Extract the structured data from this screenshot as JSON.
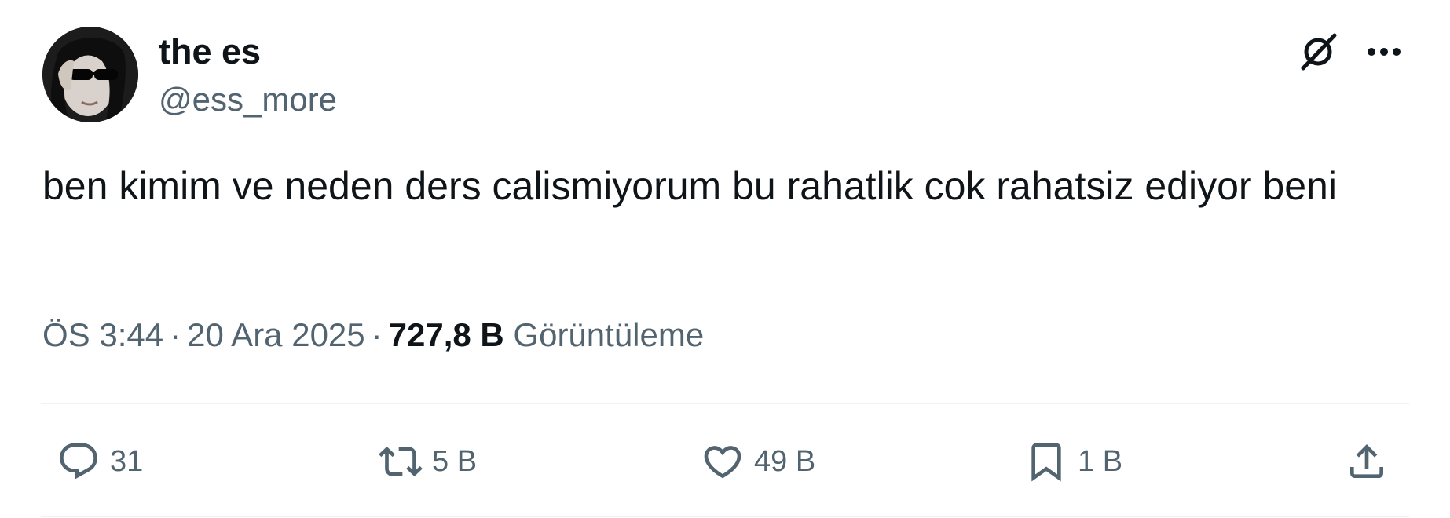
{
  "author": {
    "display_name": "the es",
    "handle": "@ess_more",
    "avatar_icon": "profile-photo"
  },
  "header_actions": {
    "grok_icon": "grok-icon",
    "more_icon": "more-dots-icon"
  },
  "tweet": {
    "text": "ben kimim ve neden ders calismiyorum bu rahatlik cok rahatsiz ediyor beni"
  },
  "meta": {
    "time": "ÖS 3:44",
    "separator": "·",
    "date": "20 Ara 2025",
    "views_count": "727,8 B",
    "views_label": "Görüntüleme"
  },
  "actions": {
    "reply": {
      "icon": "reply-icon",
      "count": "31"
    },
    "retweet": {
      "icon": "retweet-icon",
      "count": "5 B"
    },
    "like": {
      "icon": "heart-icon",
      "count": "49 B"
    },
    "bookmark": {
      "icon": "bookmark-icon",
      "count": "1 B"
    },
    "share": {
      "icon": "share-icon"
    }
  },
  "colors": {
    "text_primary": "#0f1419",
    "text_secondary": "#536471",
    "divider": "#eff3f4",
    "background": "#ffffff"
  }
}
